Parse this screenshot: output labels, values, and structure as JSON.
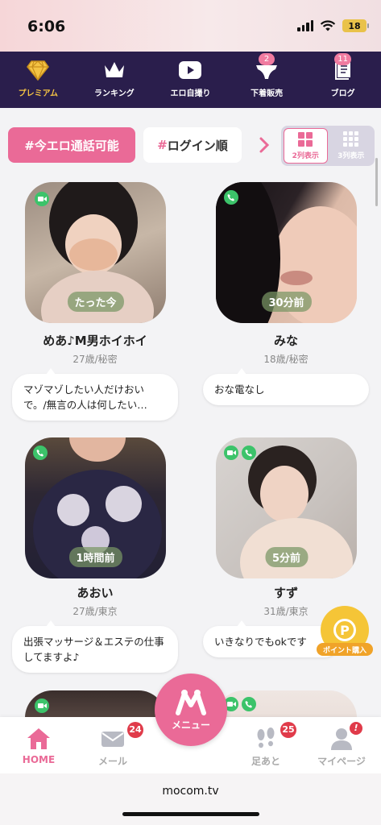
{
  "status_bar": {
    "time": "6:06",
    "battery": "18"
  },
  "top_nav": {
    "items": [
      {
        "label": "プレミアム",
        "icon": "diamond-icon",
        "active": true
      },
      {
        "label": "ランキング",
        "icon": "crown-icon"
      },
      {
        "label": "エロ自撮り",
        "icon": "play-icon"
      },
      {
        "label": "下着販売",
        "icon": "underwear-icon",
        "badge": "2"
      },
      {
        "label": "ブログ",
        "icon": "notebook-icon",
        "badge": "11"
      }
    ]
  },
  "filters": {
    "active_tag": "#今エロ通話可能",
    "sort_tag_hash": "#",
    "sort_tag_label": "ログイン順",
    "view_2col": "2列表示",
    "view_3col": "3列表示"
  },
  "profiles": [
    {
      "name": "めあ♪M男ホイホイ",
      "meta": "27歳/秘密",
      "status": "たった今",
      "message": "マゾマゾしたい人だけおいで。/無言の人は何したい…",
      "icons": [
        "video-icon"
      ]
    },
    {
      "name": "みな",
      "meta": "18歳/秘密",
      "status": "30分前",
      "message": "おな電なし",
      "icons": [
        "phone-icon"
      ]
    },
    {
      "name": "あおい",
      "meta": "27歳/東京",
      "status": "1時間前",
      "message": "出張マッサージ＆エステの仕事してますよ♪",
      "icons": [
        "phone-icon"
      ]
    },
    {
      "name": "すず",
      "meta": "31歳/東京",
      "status": "5分前",
      "message": "いきなりでもokです",
      "icons": [
        "video-icon",
        "phone-icon"
      ]
    }
  ],
  "partial_row_icons": {
    "left": [
      "video-icon"
    ],
    "right": [
      "video-icon",
      "phone-icon"
    ]
  },
  "point_button": {
    "label": "ポイント購入",
    "symbol": "P"
  },
  "bottom_nav": {
    "home": "HOME",
    "mail": "メール",
    "mail_badge": "24",
    "menu": "メニュー",
    "footprints": "足あと",
    "footprints_badge": "25",
    "mypage": "マイページ",
    "mypage_badge": "!"
  },
  "browser": {
    "url": "mocom.tv"
  },
  "colors": {
    "brand_pink": "#ea6a97",
    "nav_bg": "#2a1e4c",
    "online_green": "#3cc36a",
    "gold": "#f4c344"
  }
}
